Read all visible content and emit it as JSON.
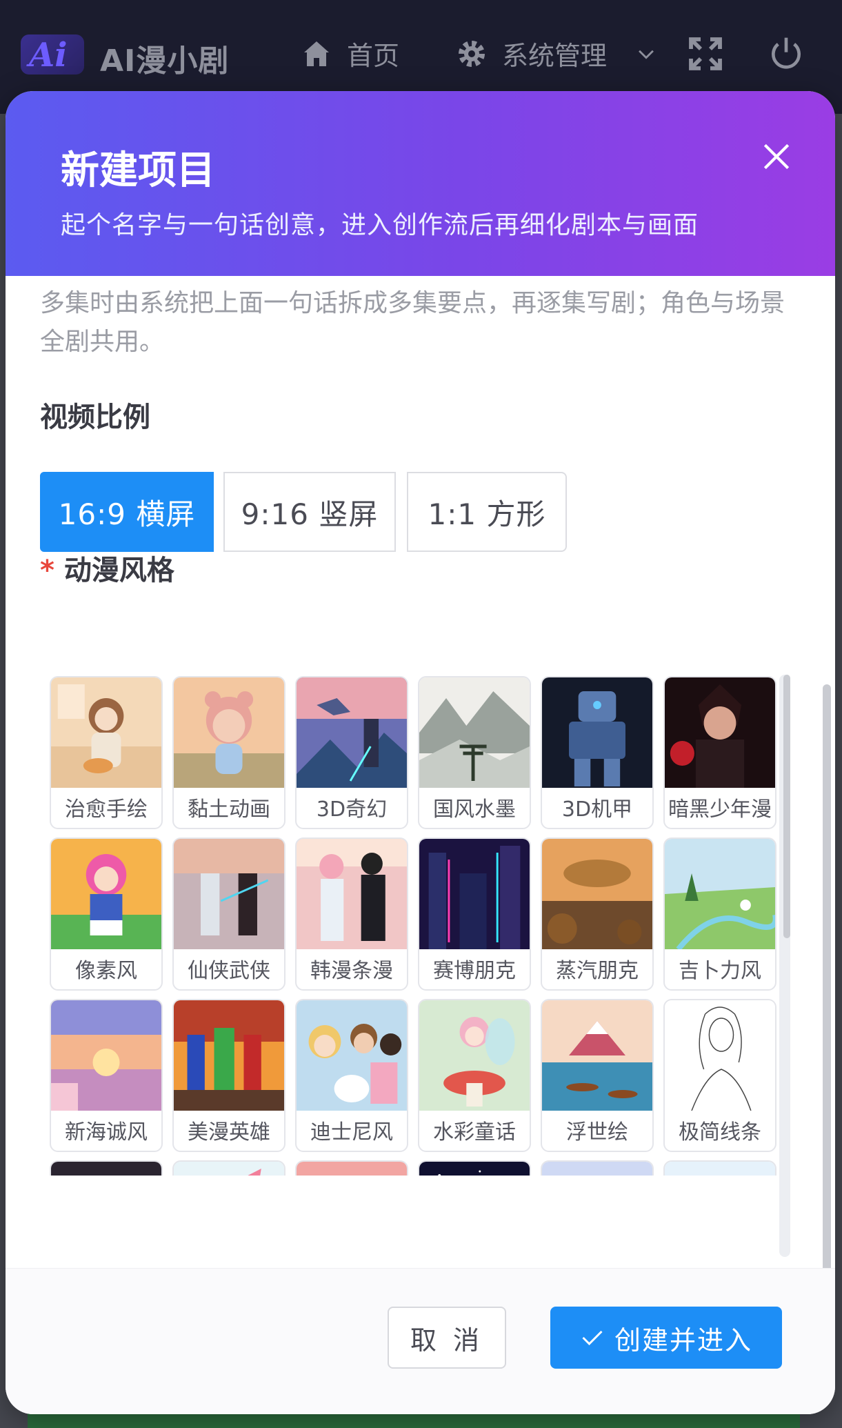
{
  "app": {
    "name": "AI漫小剧",
    "logo_text": "Ai"
  },
  "nav": {
    "home": "首页",
    "system": "系统管理"
  },
  "modal": {
    "title": "新建项目",
    "subtitle": "起个名字与一句话创意，进入创作流后再细化剧本与画面",
    "hint": "多集时由系统把上面一句话拆成多集要点，再逐集写剧；角色与场景全剧共用。",
    "ratio_label": "视频比例",
    "ratios": [
      "16:9 横屏",
      "9:16 竖屏",
      "1:1 方形"
    ],
    "selected_ratio": "16:9 横屏",
    "style_label": "动漫风格",
    "required_mark": "*",
    "styles": [
      {
        "name": "治愈手绘",
        "icon": "healing-handdrawn-thumb"
      },
      {
        "name": "黏土动画",
        "icon": "clay-animation-thumb"
      },
      {
        "name": "3D奇幻",
        "icon": "3d-fantasy-thumb"
      },
      {
        "name": "国风水墨",
        "icon": "ink-wash-thumb"
      },
      {
        "name": "3D机甲",
        "icon": "3d-mecha-thumb"
      },
      {
        "name": "暗黑少年漫",
        "icon": "dark-shonen-thumb"
      },
      {
        "name": "像素风",
        "icon": "pixel-thumb"
      },
      {
        "name": "仙侠武侠",
        "icon": "xianxia-thumb"
      },
      {
        "name": "韩漫条漫",
        "icon": "webtoon-thumb"
      },
      {
        "name": "赛博朋克",
        "icon": "cyberpunk-thumb"
      },
      {
        "name": "蒸汽朋克",
        "icon": "steampunk-thumb"
      },
      {
        "name": "吉卜力风",
        "icon": "ghibli-thumb"
      },
      {
        "name": "新海诚风",
        "icon": "shinkai-thumb"
      },
      {
        "name": "美漫英雄",
        "icon": "american-hero-thumb"
      },
      {
        "name": "迪士尼风",
        "icon": "disney-thumb"
      },
      {
        "name": "水彩童话",
        "icon": "watercolor-thumb"
      },
      {
        "name": "浮世绘",
        "icon": "ukiyoe-thumb"
      },
      {
        "name": "极简线条",
        "icon": "minimal-line-thumb"
      },
      {
        "name": "",
        "icon": "gothic-thumb"
      },
      {
        "name": "",
        "icon": "chibi-thumb"
      },
      {
        "name": "",
        "icon": "retro-anime-thumb"
      },
      {
        "name": "",
        "icon": "space-scifi-thumb"
      },
      {
        "name": "",
        "icon": "dreamy-pastel-thumb"
      },
      {
        "name": "",
        "icon": "battle-anime-thumb"
      }
    ],
    "cancel_label": "取 消",
    "create_label": "创建并进入"
  },
  "colors": {
    "accent": "#1d8ef6",
    "header_from": "#5b5bf0",
    "header_to": "#9a3de4",
    "required": "#e8473c"
  }
}
